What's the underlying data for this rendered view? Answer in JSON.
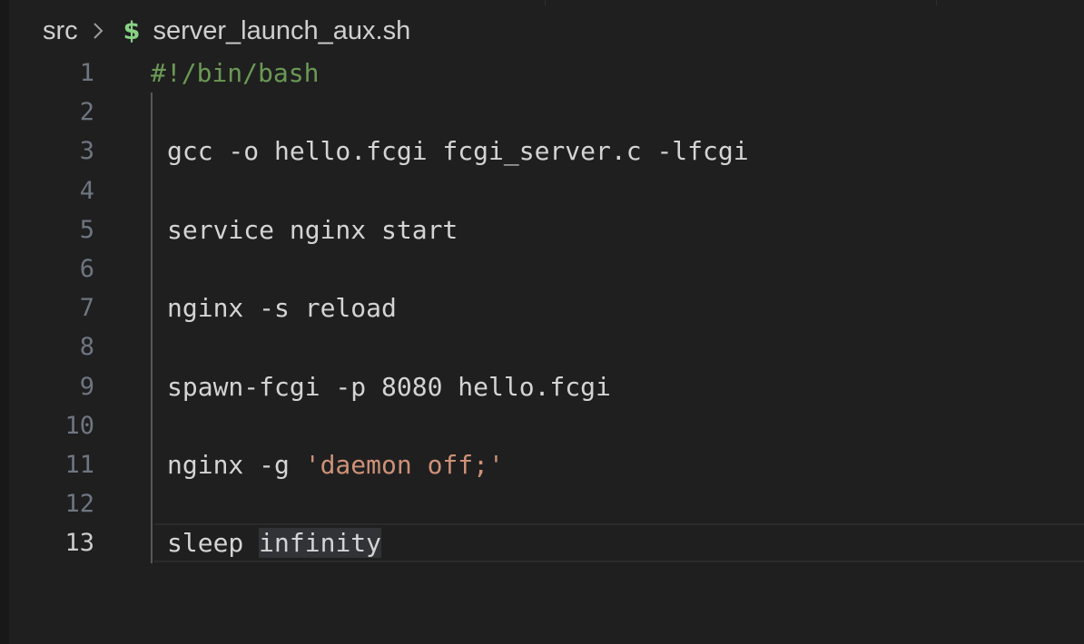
{
  "breadcrumb": {
    "folder": "src",
    "file_icon": "$",
    "file": "server_launch_aux.sh"
  },
  "editor": {
    "active_line": "13",
    "lines": [
      {
        "num": "1",
        "text": "#!/bin/bash"
      },
      {
        "num": "2",
        "text": ""
      },
      {
        "num": "3",
        "text": "gcc -o hello.fcgi fcgi_server.c -lfcgi"
      },
      {
        "num": "4",
        "text": ""
      },
      {
        "num": "5",
        "text": "service nginx start"
      },
      {
        "num": "6",
        "text": ""
      },
      {
        "num": "7",
        "text": "nginx -s reload"
      },
      {
        "num": "8",
        "text": ""
      },
      {
        "num": "9",
        "text": "spawn-fcgi -p 8080 hello.fcgi"
      },
      {
        "num": "10",
        "text": ""
      },
      {
        "num": "11",
        "text_prefix": "nginx -g ",
        "text_string": "'daemon off;'"
      },
      {
        "num": "12",
        "text": ""
      },
      {
        "num": "13",
        "text_prefix": "sleep ",
        "text_highlight": "infinity"
      }
    ]
  },
  "colors": {
    "background": "#1f1f1f",
    "text": "#d4d4d4",
    "comment": "#6a9955",
    "string": "#ce9178",
    "line_number": "#6e7681",
    "shell_icon": "#89d185"
  }
}
